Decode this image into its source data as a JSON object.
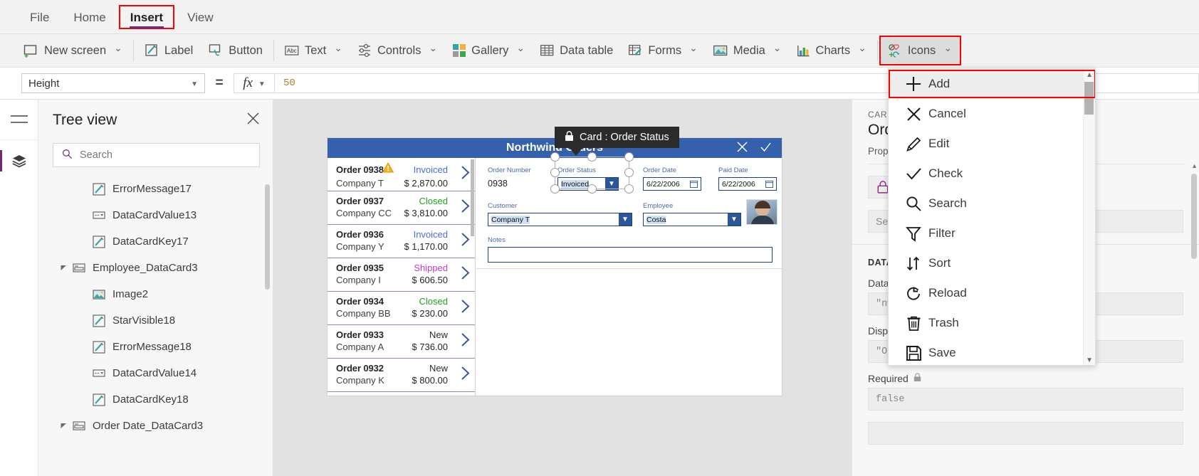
{
  "menubar": {
    "tabs": [
      {
        "label": "File",
        "active": false
      },
      {
        "label": "Home",
        "active": false
      },
      {
        "label": "Insert",
        "active": true
      },
      {
        "label": "View",
        "active": false
      }
    ]
  },
  "ribbon": {
    "items": [
      {
        "label": "New screen",
        "icon": "new-screen-icon",
        "caret": true
      },
      {
        "label": "Label",
        "icon": "label-icon",
        "caret": false
      },
      {
        "label": "Button",
        "icon": "button-icon",
        "caret": false
      },
      {
        "label": "Text",
        "icon": "text-abc-icon",
        "caret": true
      },
      {
        "label": "Controls",
        "icon": "controls-sliders-icon",
        "caret": true
      },
      {
        "label": "Gallery",
        "icon": "gallery-grid-icon",
        "caret": true
      },
      {
        "label": "Data table",
        "icon": "data-table-icon",
        "caret": false
      },
      {
        "label": "Forms",
        "icon": "forms-icon",
        "caret": true
      },
      {
        "label": "Media",
        "icon": "media-image-icon",
        "caret": true
      },
      {
        "label": "Charts",
        "icon": "charts-bar-icon",
        "caret": true
      },
      {
        "label": "Icons",
        "icon": "icons-shapes-icon",
        "caret": true,
        "pressed": true,
        "highlight": true
      }
    ]
  },
  "formula_bar": {
    "property": "Height",
    "equals": "=",
    "fx_label": "fx",
    "value": "50"
  },
  "tree_view": {
    "title": "Tree view",
    "close_icon": "close-icon",
    "search_placeholder": "Search",
    "search_icon": "search-icon",
    "items": [
      {
        "label": "ErrorMessage17",
        "icon": "pencil-edit-icon",
        "indent": 1,
        "twisty": ""
      },
      {
        "label": "DataCardValue13",
        "icon": "dropdown-control-icon",
        "indent": 1,
        "twisty": ""
      },
      {
        "label": "DataCardKey17",
        "icon": "pencil-edit-icon",
        "indent": 1,
        "twisty": ""
      },
      {
        "label": "Employee_DataCard3",
        "icon": "datacard-icon",
        "indent": 0,
        "twisty": "expanded"
      },
      {
        "label": "Image2",
        "icon": "image-icon",
        "indent": 1,
        "twisty": ""
      },
      {
        "label": "StarVisible18",
        "icon": "pencil-edit-icon",
        "indent": 1,
        "twisty": ""
      },
      {
        "label": "ErrorMessage18",
        "icon": "pencil-edit-icon",
        "indent": 1,
        "twisty": ""
      },
      {
        "label": "DataCardValue14",
        "icon": "dropdown-control-icon",
        "indent": 1,
        "twisty": ""
      },
      {
        "label": "DataCardKey18",
        "icon": "pencil-edit-icon",
        "indent": 1,
        "twisty": ""
      },
      {
        "label": "Order Date_DataCard3",
        "icon": "datacard-icon",
        "indent": 0,
        "twisty": "expanded"
      }
    ]
  },
  "canvas": {
    "app_title": "Northwind Orders",
    "header_icons": [
      "cancel-x-icon",
      "check-icon"
    ],
    "gallery": [
      {
        "order": "Order 0938",
        "company": "Company T",
        "status": "Invoiced",
        "status_color": "#4a6ee0",
        "amount": "$ 2,870.00",
        "warning": true
      },
      {
        "order": "Order 0937",
        "company": "Company CC",
        "status": "Closed",
        "status_color": "#21a121",
        "amount": "$ 3,810.00",
        "warning": false
      },
      {
        "order": "Order 0936",
        "company": "Company Y",
        "status": "Invoiced",
        "status_color": "#4a6ee0",
        "amount": "$ 1,170.00",
        "warning": false
      },
      {
        "order": "Order 0935",
        "company": "Company I",
        "status": "Shipped",
        "status_color": "#c23ec2",
        "amount": "$ 606.50",
        "warning": false
      },
      {
        "order": "Order 0934",
        "company": "Company BB",
        "status": "Closed",
        "status_color": "#21a121",
        "amount": "$ 230.00",
        "warning": false
      },
      {
        "order": "Order 0933",
        "company": "Company A",
        "status": "New",
        "status_color": "#2b2b2b",
        "amount": "$ 736.00",
        "warning": false
      },
      {
        "order": "Order 0932",
        "company": "Company K",
        "status": "New",
        "status_color": "#2b2b2b",
        "amount": "$ 800.00",
        "warning": false
      }
    ],
    "form": {
      "order_number_label": "Order Number",
      "order_number_value": "0938",
      "order_status_label": "Order Status",
      "order_status_value": "Invoiced",
      "order_date_label": "Order Date",
      "order_date_value": "6/22/2006",
      "paid_date_label": "Paid Date",
      "paid_date_value": "6/22/2006",
      "customer_label": "Customer",
      "customer_value": "Company T",
      "employee_label": "Employee",
      "employee_value": "Costa",
      "notes_label": "Notes",
      "notes_value": ""
    },
    "tooltip": {
      "text": "Card : Order Status",
      "icon": "lock-icon"
    }
  },
  "properties_panel": {
    "kicker": "CARD",
    "title": "Order Status",
    "subtitle": "Properties",
    "lock_icon": "lock-icon",
    "search_placeholder": "Search",
    "section_data": "DATA",
    "datafield_label": "DataField",
    "datafield_value": "\"nwind_orderstatus\"",
    "displayname_label": "DisplayName",
    "displayname_value": "\"Order Status\"",
    "required_label": "Required",
    "required_value": "false"
  },
  "icons_menu": {
    "scroll_up_icon": "chevron-up-icon",
    "scroll_down_icon": "chevron-down-icon",
    "items": [
      {
        "label": "Add",
        "icon": "plus-icon",
        "selected": true
      },
      {
        "label": "Cancel",
        "icon": "x-icon",
        "selected": false
      },
      {
        "label": "Edit",
        "icon": "pencil-icon",
        "selected": false
      },
      {
        "label": "Check",
        "icon": "checkmark-icon",
        "selected": false
      },
      {
        "label": "Search",
        "icon": "magnifier-icon",
        "selected": false
      },
      {
        "label": "Filter",
        "icon": "funnel-icon",
        "selected": false
      },
      {
        "label": "Sort",
        "icon": "sort-arrows-icon",
        "selected": false
      },
      {
        "label": "Reload",
        "icon": "reload-circle-icon",
        "selected": false
      },
      {
        "label": "Trash",
        "icon": "trash-icon",
        "selected": false
      },
      {
        "label": "Save",
        "icon": "floppy-disk-icon",
        "selected": false
      }
    ]
  },
  "colors": {
    "accent_purple": "#742774",
    "highlight_red": "#ff0000",
    "app_blue": "#3560ab",
    "formula_orange": "#b07d2b"
  }
}
